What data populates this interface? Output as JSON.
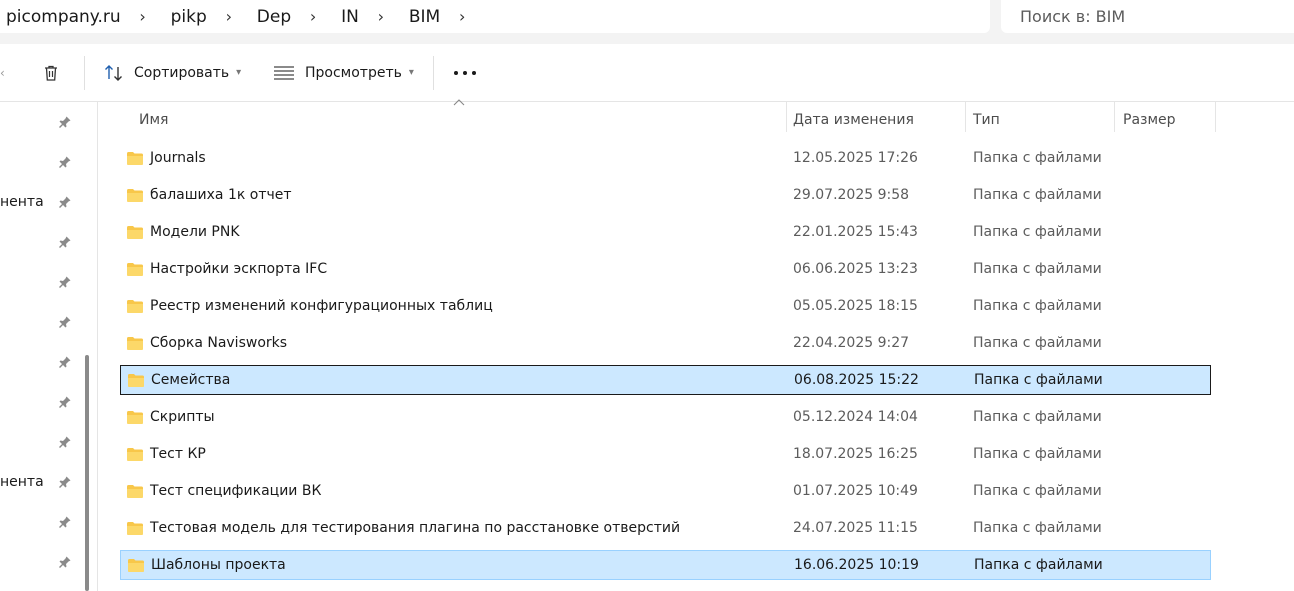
{
  "breadcrumb": [
    "picompany.ru",
    "pikp",
    "Dep",
    "IN",
    "BIM"
  ],
  "search": {
    "placeholder": "Поиск в: BIM"
  },
  "toolbar": {
    "sort_label": "Сортировать",
    "view_label": "Просмотреть"
  },
  "sidebar": {
    "partial_labels": [
      "нента",
      "нента"
    ]
  },
  "columns": {
    "name": "Имя",
    "date": "Дата изменения",
    "type": "Тип",
    "size": "Размер"
  },
  "rows": [
    {
      "name": "Journals",
      "date": "12.05.2025 17:26",
      "type": "Папка с файлами",
      "state": "normal"
    },
    {
      "name": "балашиха 1к отчет",
      "date": "29.07.2025 9:58",
      "type": "Папка с файлами",
      "state": "normal"
    },
    {
      "name": "Модели PNK",
      "date": "22.01.2025 15:43",
      "type": "Папка с файлами",
      "state": "normal"
    },
    {
      "name": "Настройки эскпорта IFC",
      "date": "06.06.2025 13:23",
      "type": "Папка с файлами",
      "state": "normal"
    },
    {
      "name": "Реестр изменений конфигурационных таблиц",
      "date": "05.05.2025 18:15",
      "type": "Папка с файлами",
      "state": "normal"
    },
    {
      "name": "Сборка Navisworks",
      "date": "22.04.2025 9:27",
      "type": "Папка с файлами",
      "state": "normal"
    },
    {
      "name": "Семейства",
      "date": "06.08.2025 15:22",
      "type": "Папка с файлами",
      "state": "focused"
    },
    {
      "name": "Скрипты",
      "date": "05.12.2024 14:04",
      "type": "Папка с файлами",
      "state": "normal"
    },
    {
      "name": "Тест КР",
      "date": "18.07.2025 16:25",
      "type": "Папка с файлами",
      "state": "normal"
    },
    {
      "name": "Тест спецификации ВК",
      "date": "01.07.2025 10:49",
      "type": "Папка с файлами",
      "state": "normal"
    },
    {
      "name": "Тестовая модель для тестирования плагина по расстановке отверстий",
      "date": "24.07.2025 11:15",
      "type": "Папка с файлами",
      "state": "normal"
    },
    {
      "name": "Шаблоны проекта",
      "date": "16.06.2025 10:19",
      "type": "Папка с файлами",
      "state": "selected"
    }
  ],
  "colors": {
    "selection": "#cce8ff",
    "folder": "#f8c74a"
  },
  "icons": [
    "chevron-right-icon",
    "trash-icon",
    "sort-icon",
    "view-icon",
    "more-icon",
    "pin-icon",
    "folder-icon",
    "sort-up-icon"
  ]
}
